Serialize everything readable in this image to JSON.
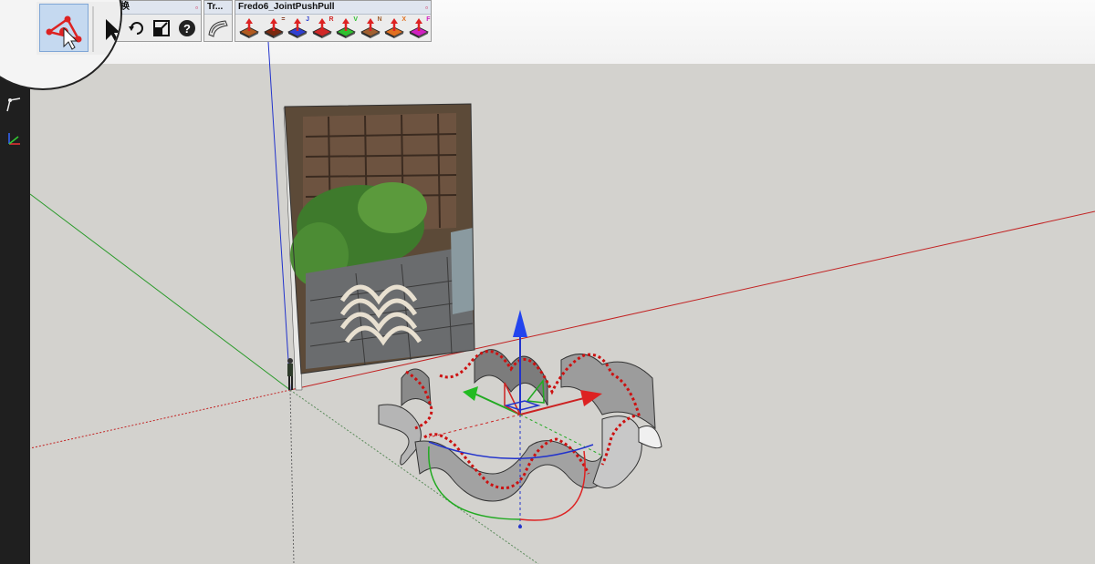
{
  "toolbars": {
    "transform": {
      "title_suffix": "变换",
      "close": "▫"
    },
    "tr": {
      "title": "Tr...",
      "close": "▫"
    },
    "fredo": {
      "title": "Fredo6_JointPushPull",
      "close": "▫",
      "letters": [
        "",
        "=",
        "J",
        "R",
        "V",
        "N",
        "X",
        "F"
      ],
      "icon_colors": [
        "#b05a1f",
        "#7a2a10",
        "#3040d0",
        "#d02828",
        "#30c030",
        "#a06030",
        "#e07020",
        "#d020c0"
      ]
    }
  },
  "icons": {
    "magnified": "vertex-edit-icon",
    "select": "select-arrow-icon",
    "rotate": "rotate-icon",
    "scale": "scale-icon",
    "help": "help-icon",
    "tr": "curve-tool-icon",
    "leftbar": [
      "rectangle-icon",
      "line-icon",
      "axes-icon"
    ]
  },
  "colors": {
    "red_axis": "#c22222",
    "green_axis": "#2a9a2a",
    "blue_axis": "#2233cc",
    "selection": "#cc1111"
  }
}
